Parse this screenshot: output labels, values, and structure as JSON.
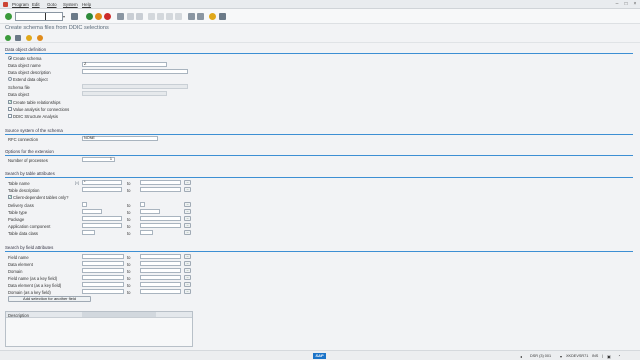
{
  "menu": {
    "items": [
      "Program",
      "Edit",
      "Goto",
      "System",
      "Help"
    ]
  },
  "toolbar": {
    "command_value": ""
  },
  "title": "Create schema files from DDIC selections",
  "sections": {
    "data_object": {
      "title": "Data object definition",
      "create_schema": "Create schema",
      "data_object_name": "Data object name",
      "data_object_name_value": "Z",
      "data_object_description": "Data object description",
      "extend_data_object": "Extend data object",
      "schema_file": "Schema file",
      "data_object": "Data object",
      "create_table_relationships": "Create table relationships",
      "value_analysis": "Value analysis for connections",
      "ddic_structure_analysis": "DDIC Structure Analysis"
    },
    "source_system": {
      "title": "Source system of the schema",
      "rfc_connection": "RFC connection",
      "rfc_value": "NONE"
    },
    "options": {
      "title": "Options for the extension",
      "number_of_processes": "Number of processes",
      "processes_value": "1"
    },
    "table_attrs": {
      "title": "Search by table attributes",
      "to": "to",
      "rows": [
        "Table name",
        "Table description",
        "Client-dependent tables only?",
        "Delivery class",
        "Table type",
        "Package",
        "Application component",
        "Table data class"
      ],
      "table_name_value": "*",
      "table_name_hint": "[=]"
    },
    "field_attrs": {
      "title": "Search by field attributes",
      "to": "to",
      "rows": [
        "Field name",
        "Data element",
        "Domain",
        "Field name (as a key field)",
        "Data element (as a key field)",
        "Domain (as a key field)"
      ],
      "add_selection_button": "Add selection for another field"
    },
    "description_table": {
      "header": "Description"
    }
  },
  "status": {
    "system": "DSR (3) 001",
    "server": "XKDEVSR71",
    "mode": "INS"
  }
}
